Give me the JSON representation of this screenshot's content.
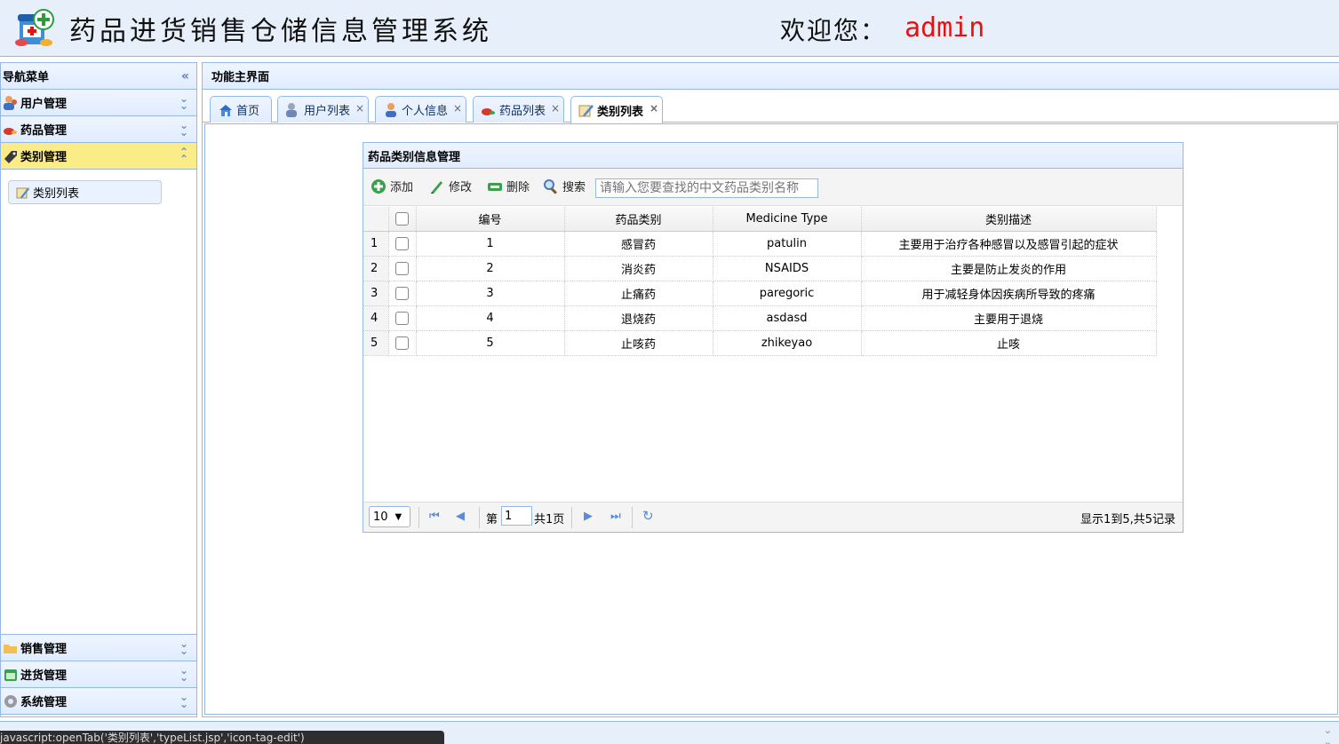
{
  "header": {
    "title": "药品进货销售仓储信息管理系统",
    "welcome": "欢迎您：",
    "username": "admin"
  },
  "nav": {
    "title": "导航菜单",
    "sections": [
      {
        "label": "用户管理",
        "icon": "users-icon"
      },
      {
        "label": "药品管理",
        "icon": "pills-icon"
      },
      {
        "label": "类别管理",
        "icon": "tag-icon"
      }
    ],
    "active_item": "类别列表",
    "bottom_sections": [
      {
        "label": "销售管理",
        "icon": "folder-icon"
      },
      {
        "label": "进货管理",
        "icon": "calendar-icon"
      },
      {
        "label": "系统管理",
        "icon": "gear-icon"
      }
    ]
  },
  "center": {
    "title": "功能主界面",
    "tabs": [
      {
        "label": "首页",
        "icon": "home-icon"
      },
      {
        "label": "用户列表",
        "icon": "users-icon"
      },
      {
        "label": "个人信息",
        "icon": "user-icon"
      },
      {
        "label": "药品列表",
        "icon": "pills-icon"
      },
      {
        "label": "类别列表",
        "icon": "tag-edit-icon"
      }
    ]
  },
  "grid": {
    "title": "药品类别信息管理",
    "toolbar": {
      "add": "添加",
      "edit": "修改",
      "delete": "删除",
      "search": "搜索",
      "search_placeholder": "请输入您要查找的中文药品类别名称"
    },
    "columns": [
      "编号",
      "药品类别",
      "Medicine Type",
      "类别描述"
    ],
    "rows": [
      {
        "rn": "1",
        "id": "1",
        "name": "感冒药",
        "type": "patulin",
        "desc": "主要用于治疗各种感冒以及感冒引起的症状"
      },
      {
        "rn": "2",
        "id": "2",
        "name": "消炎药",
        "type": "NSAIDS",
        "desc": "主要是防止发炎的作用"
      },
      {
        "rn": "3",
        "id": "3",
        "name": "止痛药",
        "type": "paregoric",
        "desc": "用于减轻身体因疾病所导致的疼痛"
      },
      {
        "rn": "4",
        "id": "4",
        "name": "退烧药",
        "type": "asdasd",
        "desc": "主要用于退烧"
      },
      {
        "rn": "5",
        "id": "5",
        "name": "止咳药",
        "type": "zhikeyao",
        "desc": "止咳"
      }
    ],
    "pager": {
      "page_size": "10",
      "page_prefix": "第",
      "page": "1",
      "page_total": "共1页",
      "summary": "显示1到5,共5记录"
    }
  },
  "status_bar": {
    "link": "javascript:openTab('类别列表','typeList.jsp','icon-tag-edit')"
  }
}
